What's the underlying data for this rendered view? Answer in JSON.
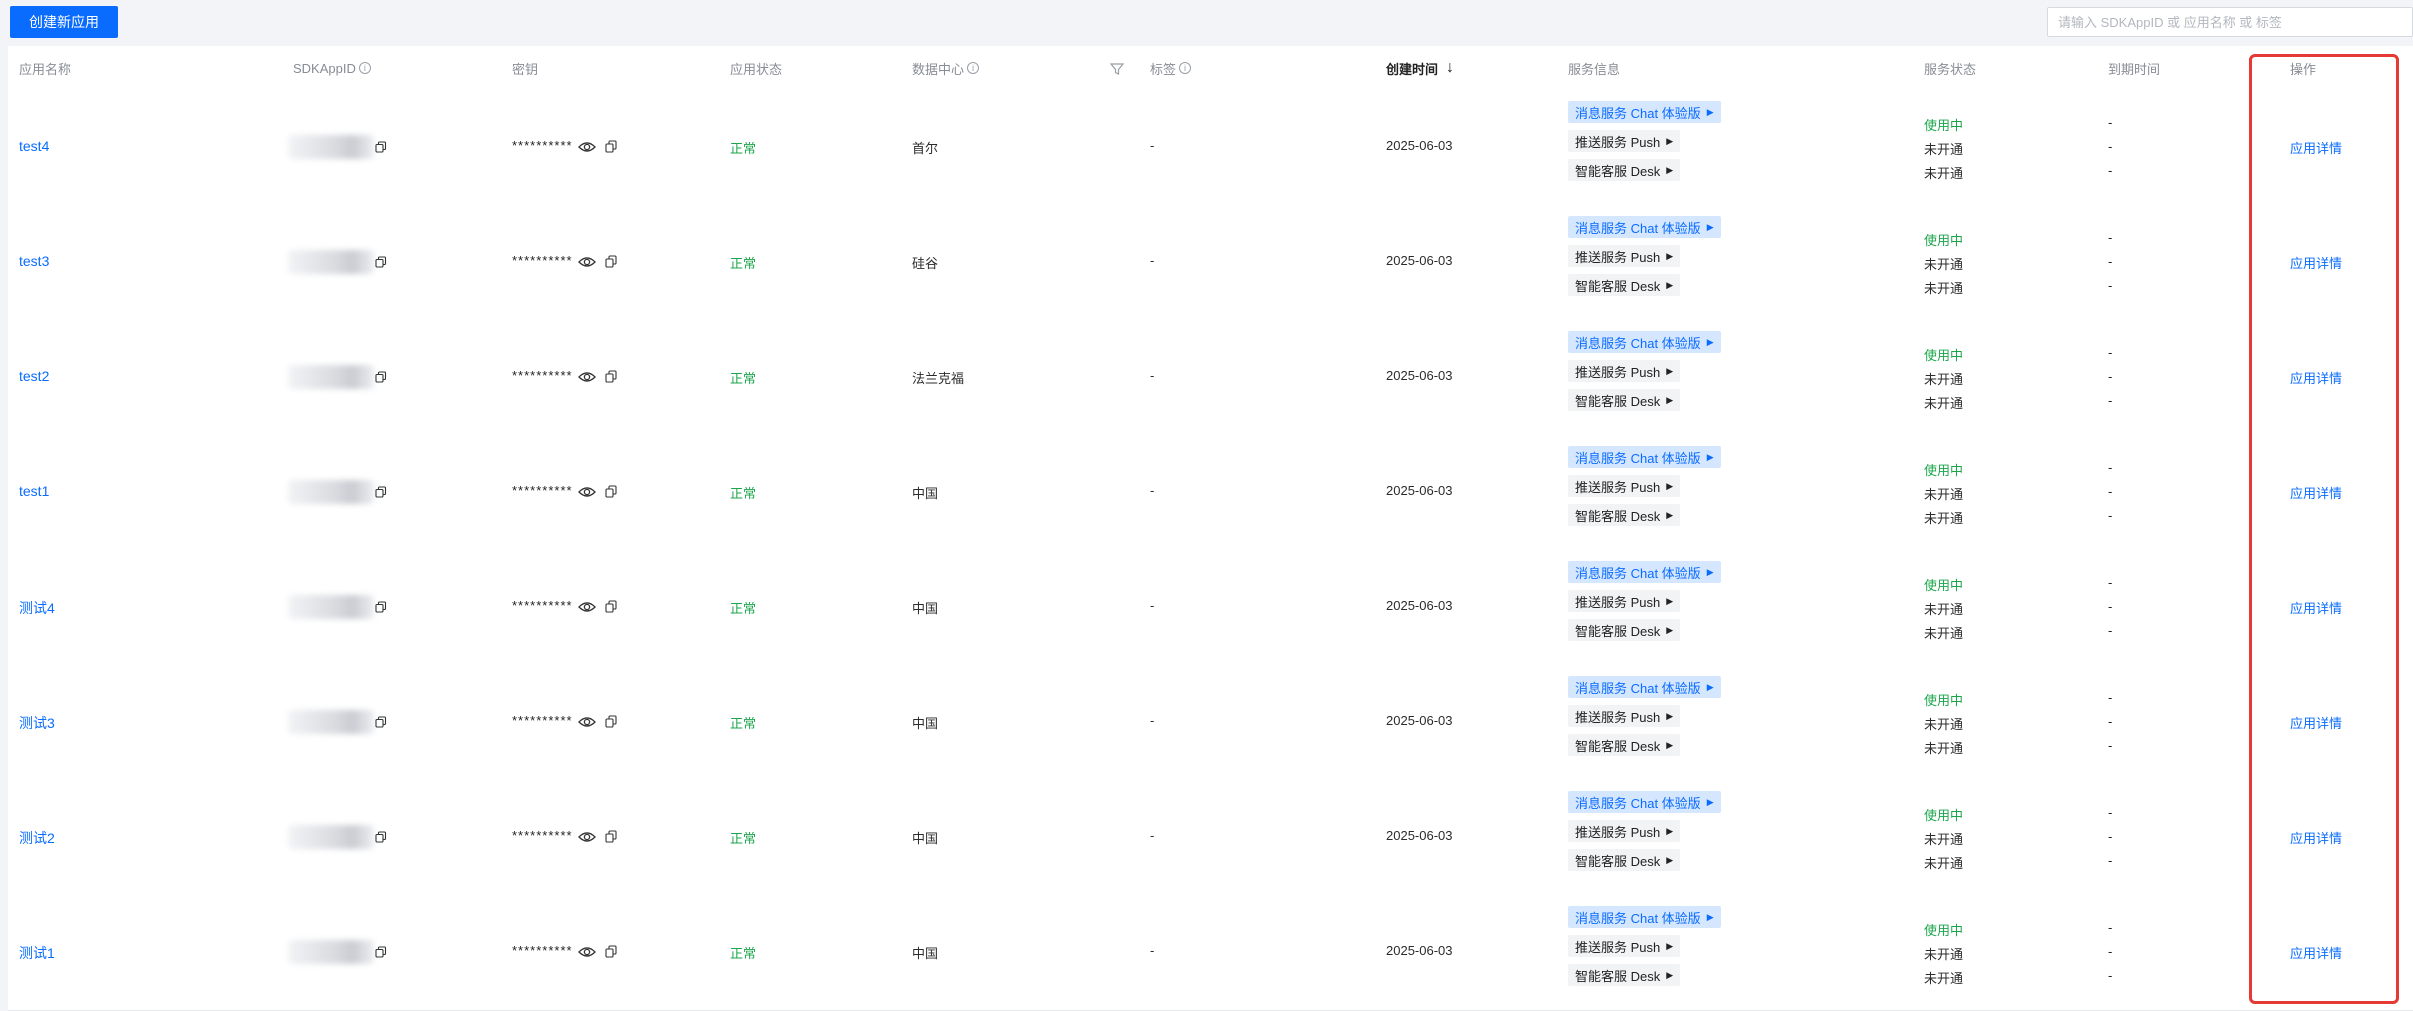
{
  "toolbar": {
    "create_label": "创建新应用",
    "search_placeholder": "请输入 SDKAppID 或 应用名称 或 标签"
  },
  "columns": {
    "app_name": "应用名称",
    "sdkappid": "SDKAppID",
    "secret": "密钥",
    "app_status": "应用状态",
    "data_center": "数据中心",
    "tags": "标签",
    "created": "创建时间",
    "service_info": "服务信息",
    "service_status": "服务状态",
    "expire": "到期时间",
    "actions": "操作"
  },
  "rows": [
    {
      "name": "test4",
      "secret": "**********",
      "status": "正常",
      "region": "首尔",
      "tag": "-",
      "created": "2025-06-03",
      "services": [
        "消息服务 Chat 体验版",
        "推送服务 Push",
        "智能客服 Desk"
      ],
      "service_states": [
        "使用中",
        "未开通",
        "未开通"
      ],
      "expires": [
        "-",
        "-",
        "-"
      ],
      "action": "应用详情"
    },
    {
      "name": "test3",
      "secret": "**********",
      "status": "正常",
      "region": "硅谷",
      "tag": "-",
      "created": "2025-06-03",
      "services": [
        "消息服务 Chat 体验版",
        "推送服务 Push",
        "智能客服 Desk"
      ],
      "service_states": [
        "使用中",
        "未开通",
        "未开通"
      ],
      "expires": [
        "-",
        "-",
        "-"
      ],
      "action": "应用详情"
    },
    {
      "name": "test2",
      "secret": "**********",
      "status": "正常",
      "region": "法兰克福",
      "tag": "-",
      "created": "2025-06-03",
      "services": [
        "消息服务 Chat 体验版",
        "推送服务 Push",
        "智能客服 Desk"
      ],
      "service_states": [
        "使用中",
        "未开通",
        "未开通"
      ],
      "expires": [
        "-",
        "-",
        "-"
      ],
      "action": "应用详情"
    },
    {
      "name": "test1",
      "secret": "**********",
      "status": "正常",
      "region": "中国",
      "tag": "-",
      "created": "2025-06-03",
      "services": [
        "消息服务 Chat 体验版",
        "推送服务 Push",
        "智能客服 Desk"
      ],
      "service_states": [
        "使用中",
        "未开通",
        "未开通"
      ],
      "expires": [
        "-",
        "-",
        "-"
      ],
      "action": "应用详情"
    },
    {
      "name": "测试4",
      "secret": "**********",
      "status": "正常",
      "region": "中国",
      "tag": "-",
      "created": "2025-06-03",
      "services": [
        "消息服务 Chat 体验版",
        "推送服务 Push",
        "智能客服 Desk"
      ],
      "service_states": [
        "使用中",
        "未开通",
        "未开通"
      ],
      "expires": [
        "-",
        "-",
        "-"
      ],
      "action": "应用详情"
    },
    {
      "name": "测试3",
      "secret": "**********",
      "status": "正常",
      "region": "中国",
      "tag": "-",
      "created": "2025-06-03",
      "services": [
        "消息服务 Chat 体验版",
        "推送服务 Push",
        "智能客服 Desk"
      ],
      "service_states": [
        "使用中",
        "未开通",
        "未开通"
      ],
      "expires": [
        "-",
        "-",
        "-"
      ],
      "action": "应用详情"
    },
    {
      "name": "测试2",
      "secret": "**********",
      "status": "正常",
      "region": "中国",
      "tag": "-",
      "created": "2025-06-03",
      "services": [
        "消息服务 Chat 体验版",
        "推送服务 Push",
        "智能客服 Desk"
      ],
      "service_states": [
        "使用中",
        "未开通",
        "未开通"
      ],
      "expires": [
        "-",
        "-",
        "-"
      ],
      "action": "应用详情"
    },
    {
      "name": "测试1",
      "secret": "**********",
      "status": "正常",
      "region": "中国",
      "tag": "-",
      "created": "2025-06-03",
      "services": [
        "消息服务 Chat 体验版",
        "推送服务 Push",
        "智能客服 Desk"
      ],
      "service_states": [
        "使用中",
        "未开通",
        "未开通"
      ],
      "expires": [
        "-",
        "-",
        "-"
      ],
      "action": "应用详情"
    }
  ],
  "colors": {
    "primary": "#0a6cff",
    "success": "#1ba54b",
    "highlight": "#e53935"
  }
}
